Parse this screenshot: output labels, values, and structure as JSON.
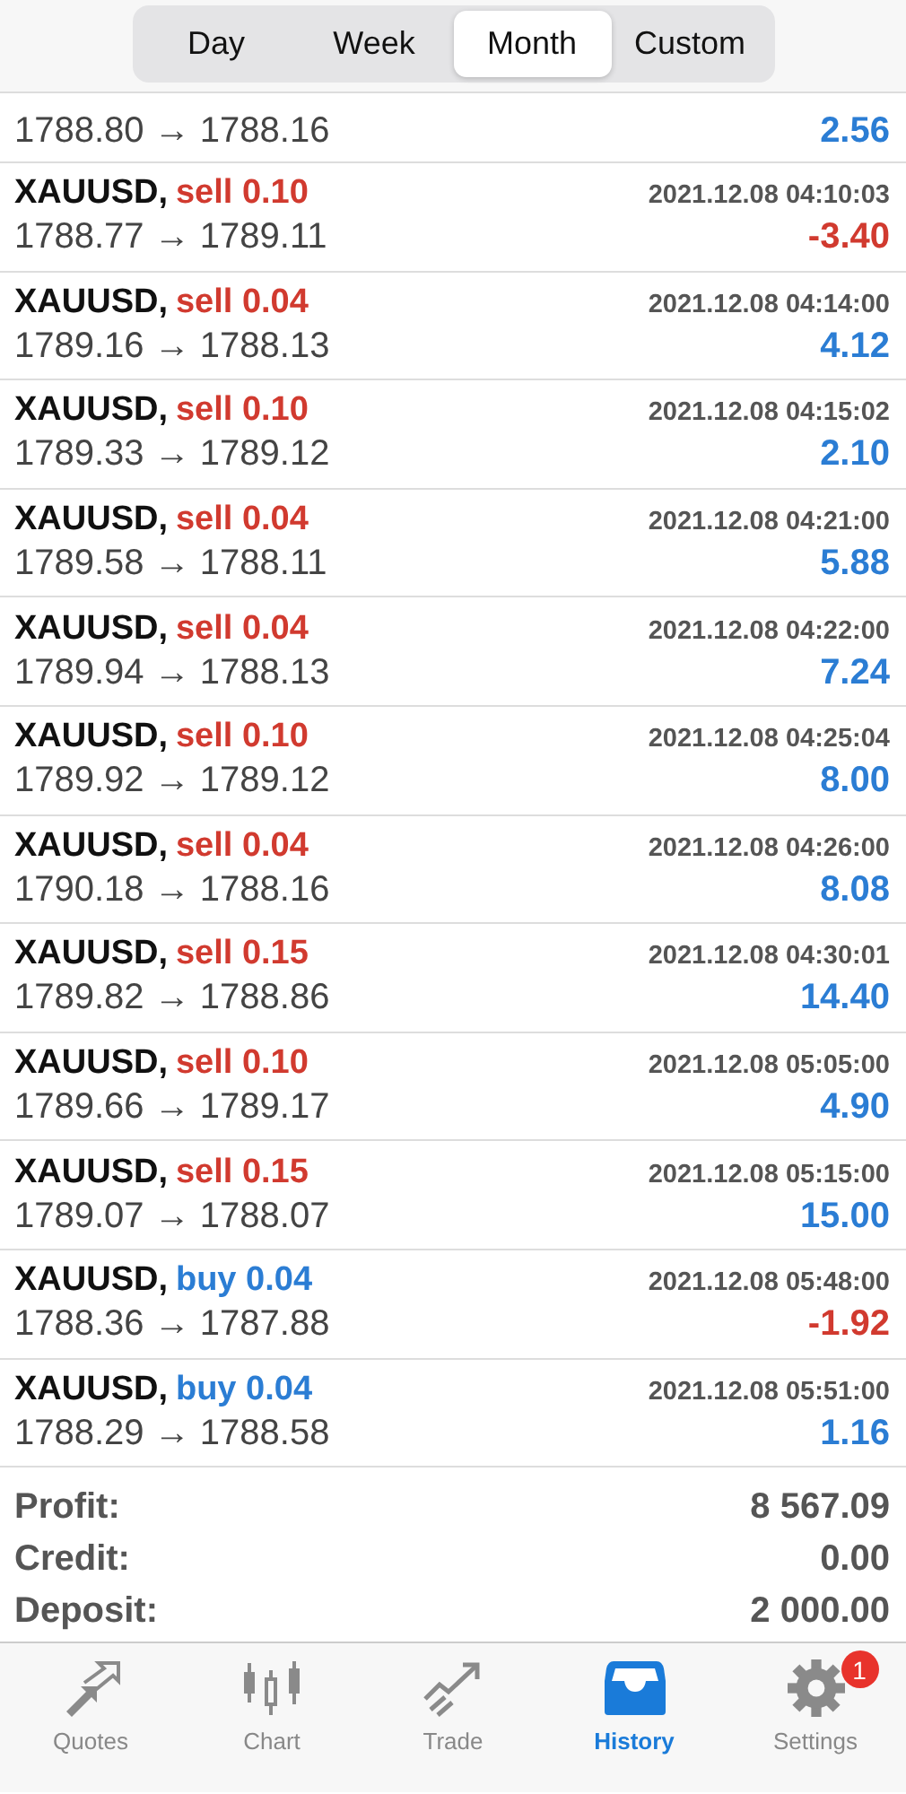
{
  "segments": [
    {
      "label": "Day",
      "selected": false
    },
    {
      "label": "Week",
      "selected": false
    },
    {
      "label": "Month",
      "selected": true
    },
    {
      "label": "Custom",
      "selected": false
    }
  ],
  "deals": [
    {
      "prices": "1788.80 → 1788.16",
      "profit": "2.56",
      "loss": false
    },
    {
      "symbol": "XAUUSD,",
      "order": "sell 0.10",
      "kind": "sell",
      "time": "2021.12.08 04:10:03",
      "prices": "1788.77 → 1789.11",
      "profit": "-3.40",
      "loss": true
    },
    {
      "symbol": "XAUUSD,",
      "order": "sell 0.04",
      "kind": "sell",
      "time": "2021.12.08 04:14:00",
      "prices": "1789.16 → 1788.13",
      "profit": "4.12",
      "loss": false
    },
    {
      "symbol": "XAUUSD,",
      "order": "sell 0.10",
      "kind": "sell",
      "time": "2021.12.08 04:15:02",
      "prices": "1789.33 → 1789.12",
      "profit": "2.10",
      "loss": false
    },
    {
      "symbol": "XAUUSD,",
      "order": "sell 0.04",
      "kind": "sell",
      "time": "2021.12.08 04:21:00",
      "prices": "1789.58 → 1788.11",
      "profit": "5.88",
      "loss": false
    },
    {
      "symbol": "XAUUSD,",
      "order": "sell 0.04",
      "kind": "sell",
      "time": "2021.12.08 04:22:00",
      "prices": "1789.94 → 1788.13",
      "profit": "7.24",
      "loss": false
    },
    {
      "symbol": "XAUUSD,",
      "order": "sell 0.10",
      "kind": "sell",
      "time": "2021.12.08 04:25:04",
      "prices": "1789.92 → 1789.12",
      "profit": "8.00",
      "loss": false
    },
    {
      "symbol": "XAUUSD,",
      "order": "sell 0.04",
      "kind": "sell",
      "time": "2021.12.08 04:26:00",
      "prices": "1790.18 → 1788.16",
      "profit": "8.08",
      "loss": false
    },
    {
      "symbol": "XAUUSD,",
      "order": "sell 0.15",
      "kind": "sell",
      "time": "2021.12.08 04:30:01",
      "prices": "1789.82 → 1788.86",
      "profit": "14.40",
      "loss": false
    },
    {
      "symbol": "XAUUSD,",
      "order": "sell 0.10",
      "kind": "sell",
      "time": "2021.12.08 05:05:00",
      "prices": "1789.66 → 1789.17",
      "profit": "4.90",
      "loss": false
    },
    {
      "symbol": "XAUUSD,",
      "order": "sell 0.15",
      "kind": "sell",
      "time": "2021.12.08 05:15:00",
      "prices": "1789.07 → 1788.07",
      "profit": "15.00",
      "loss": false
    },
    {
      "symbol": "XAUUSD,",
      "order": "buy 0.04",
      "kind": "buy",
      "time": "2021.12.08 05:48:00",
      "prices": "1788.36 → 1787.88",
      "profit": "-1.92",
      "loss": true
    },
    {
      "symbol": "XAUUSD,",
      "order": "buy 0.04",
      "kind": "buy",
      "time": "2021.12.08 05:51:00",
      "prices": "1788.29 → 1788.58",
      "profit": "1.16",
      "loss": false
    }
  ],
  "summary": [
    {
      "label": "Profit:",
      "value": "8 567.09"
    },
    {
      "label": "Credit:",
      "value": "0.00"
    },
    {
      "label": "Deposit:",
      "value": "2 000.00"
    }
  ],
  "tabbar": [
    {
      "kind": "quotes",
      "label": "Quotes",
      "selected": false
    },
    {
      "kind": "chart",
      "label": "Chart",
      "selected": false
    },
    {
      "kind": "trade",
      "label": "Trade",
      "selected": false
    },
    {
      "kind": "history",
      "label": "History",
      "selected": true
    },
    {
      "kind": "settings",
      "label": "Settings",
      "selected": false,
      "badge": "1"
    }
  ]
}
